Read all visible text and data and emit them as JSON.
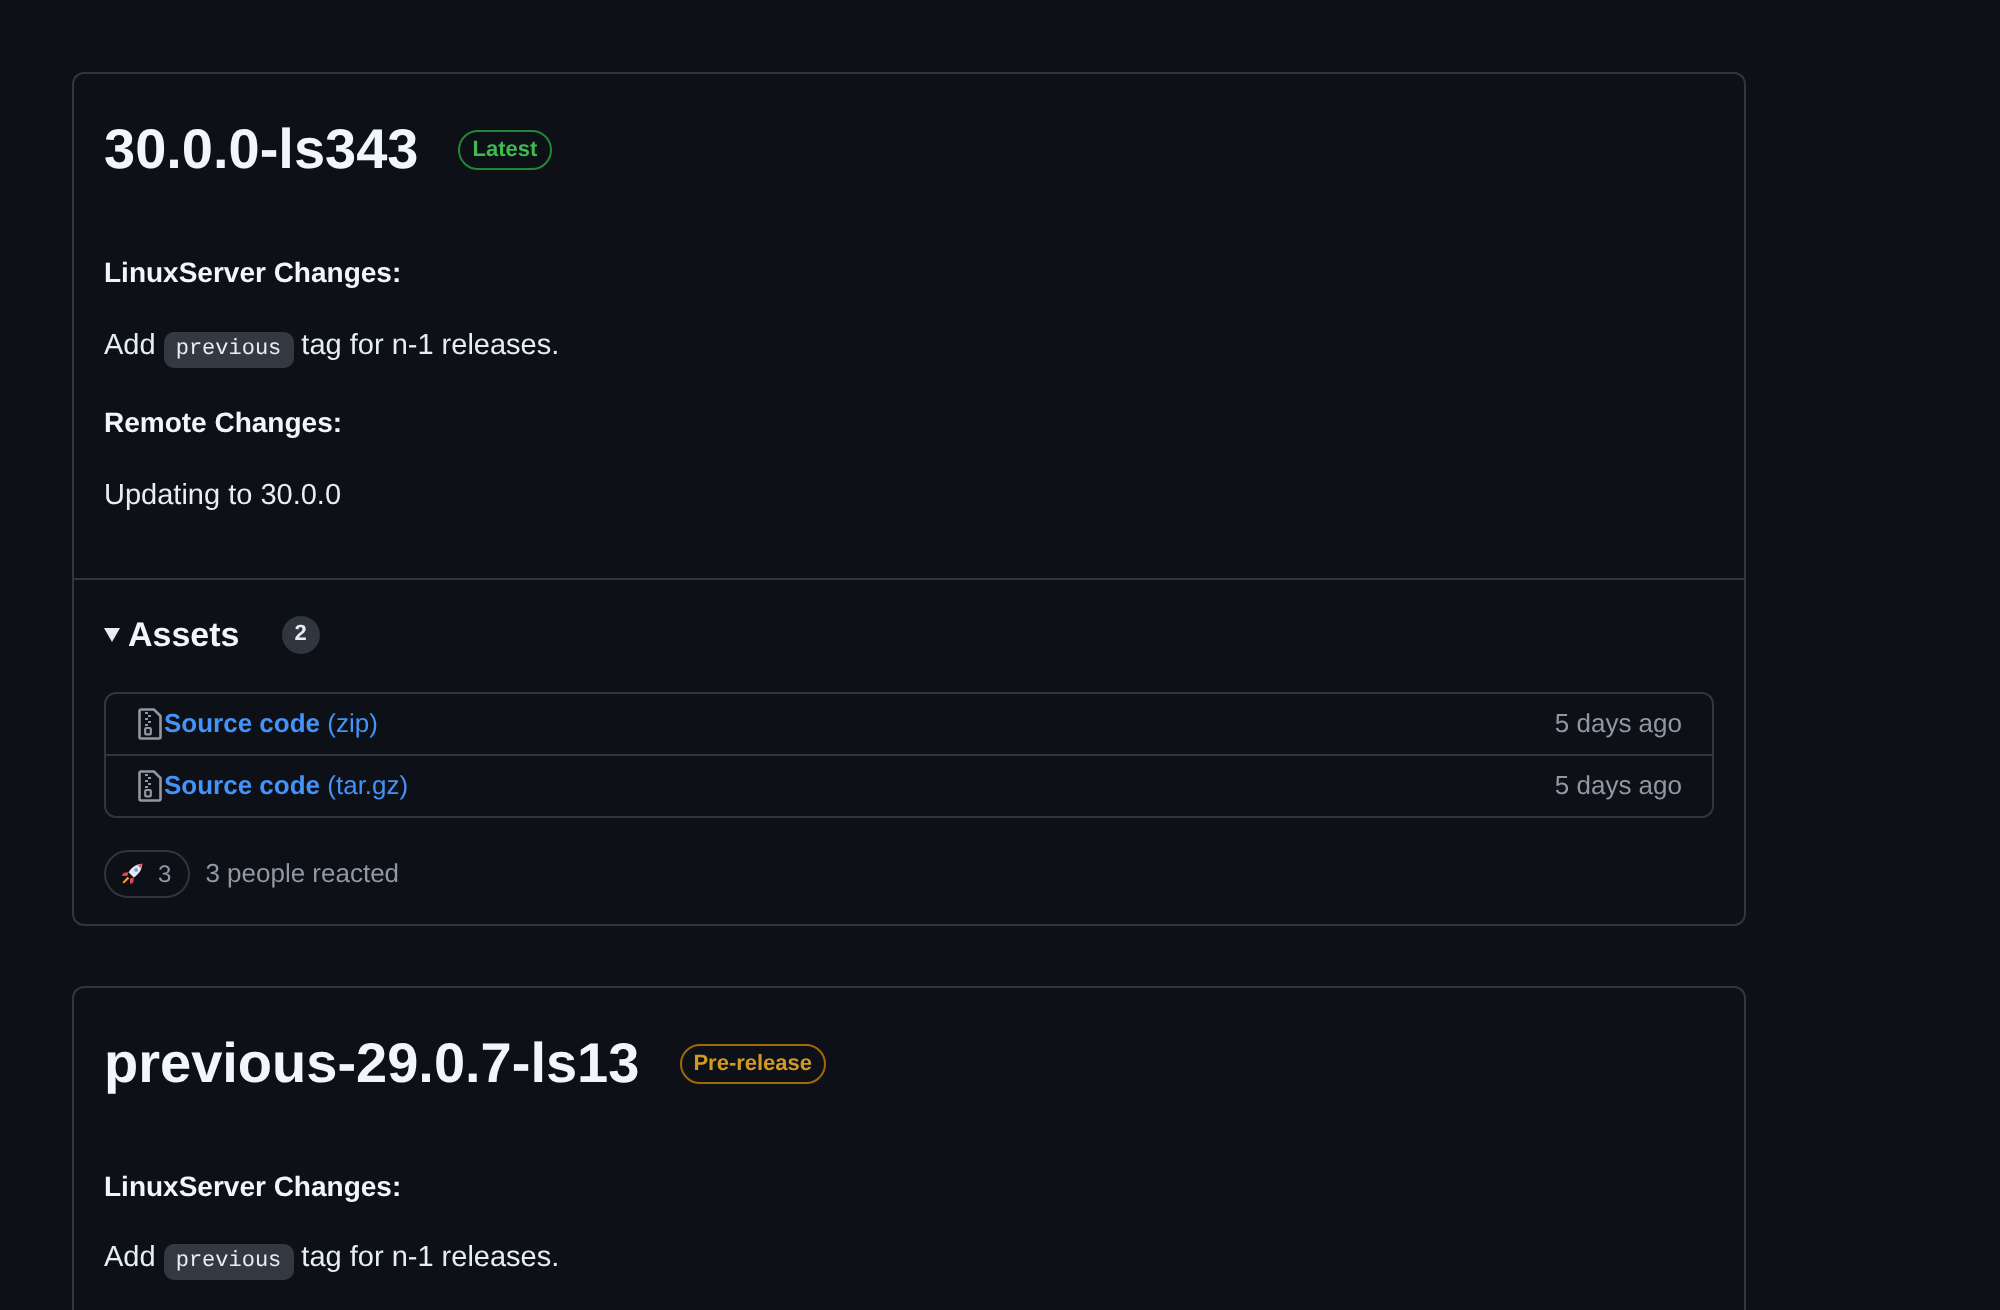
{
  "releases": [
    {
      "title": "30.0.0-ls343",
      "badge": {
        "kind": "latest",
        "label": "Latest"
      },
      "notes": [
        {
          "kind": "heading",
          "text": "LinuxServer Changes:"
        },
        {
          "kind": "paragraph",
          "parts": [
            {
              "kind": "text",
              "text": "Add "
            },
            {
              "kind": "code",
              "text": "previous"
            },
            {
              "kind": "text",
              "text": " tag for n-1 releases."
            }
          ]
        },
        {
          "kind": "heading",
          "text": "Remote Changes:"
        },
        {
          "kind": "paragraph",
          "parts": [
            {
              "kind": "text",
              "text": "Updating to 30.0.0"
            }
          ]
        }
      ],
      "assets": {
        "title": "Assets",
        "expanded": true,
        "count": "2",
        "items": [
          {
            "name": "**Source code** (zip)",
            "date": "5 days ago"
          },
          {
            "name": "**Source code** (tar.gz)",
            "date": "5 days ago"
          }
        ]
      },
      "reactions": [
        {
          "count": "3"
        }
      ],
      "reaction_summary": "3 people reacted"
    },
    {
      "title": "previous-29.0.7-ls13",
      "badge": {
        "kind": "prerelease",
        "label": "Pre-release"
      },
      "notes": [
        {
          "kind": "heading",
          "text": "LinuxServer Changes:"
        },
        {
          "kind": "paragraph",
          "parts": [
            {
              "kind": "text",
              "text": "Add "
            },
            {
              "kind": "code",
              "text": "previous"
            },
            {
              "kind": "text",
              "text": " tag for n-1 releases."
            }
          ]
        }
      ]
    }
  ]
}
